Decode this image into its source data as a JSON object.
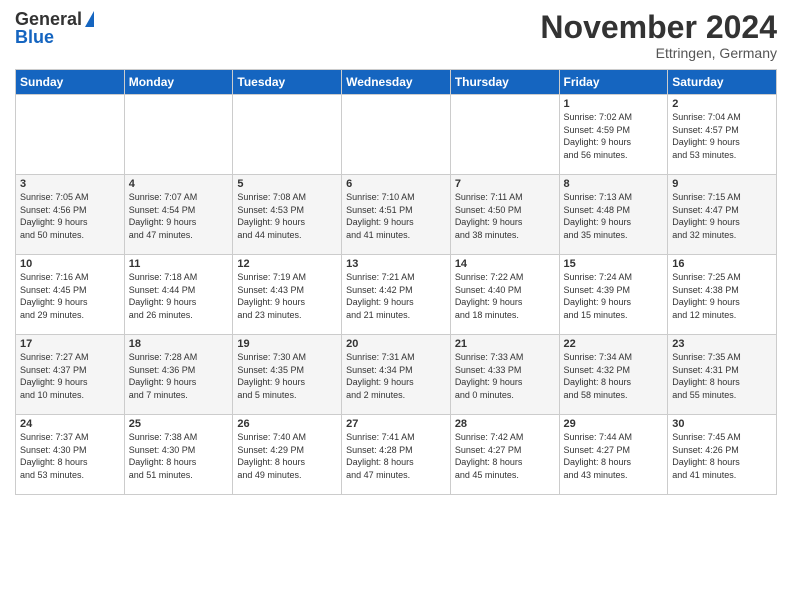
{
  "logo": {
    "general": "General",
    "blue": "Blue"
  },
  "title": "November 2024",
  "location": "Ettringen, Germany",
  "days_header": [
    "Sunday",
    "Monday",
    "Tuesday",
    "Wednesday",
    "Thursday",
    "Friday",
    "Saturday"
  ],
  "weeks": [
    {
      "cells": [
        {
          "day": "",
          "info": ""
        },
        {
          "day": "",
          "info": ""
        },
        {
          "day": "",
          "info": ""
        },
        {
          "day": "",
          "info": ""
        },
        {
          "day": "",
          "info": ""
        },
        {
          "day": "1",
          "info": "Sunrise: 7:02 AM\nSunset: 4:59 PM\nDaylight: 9 hours\nand 56 minutes."
        },
        {
          "day": "2",
          "info": "Sunrise: 7:04 AM\nSunset: 4:57 PM\nDaylight: 9 hours\nand 53 minutes."
        }
      ]
    },
    {
      "cells": [
        {
          "day": "3",
          "info": "Sunrise: 7:05 AM\nSunset: 4:56 PM\nDaylight: 9 hours\nand 50 minutes."
        },
        {
          "day": "4",
          "info": "Sunrise: 7:07 AM\nSunset: 4:54 PM\nDaylight: 9 hours\nand 47 minutes."
        },
        {
          "day": "5",
          "info": "Sunrise: 7:08 AM\nSunset: 4:53 PM\nDaylight: 9 hours\nand 44 minutes."
        },
        {
          "day": "6",
          "info": "Sunrise: 7:10 AM\nSunset: 4:51 PM\nDaylight: 9 hours\nand 41 minutes."
        },
        {
          "day": "7",
          "info": "Sunrise: 7:11 AM\nSunset: 4:50 PM\nDaylight: 9 hours\nand 38 minutes."
        },
        {
          "day": "8",
          "info": "Sunrise: 7:13 AM\nSunset: 4:48 PM\nDaylight: 9 hours\nand 35 minutes."
        },
        {
          "day": "9",
          "info": "Sunrise: 7:15 AM\nSunset: 4:47 PM\nDaylight: 9 hours\nand 32 minutes."
        }
      ]
    },
    {
      "cells": [
        {
          "day": "10",
          "info": "Sunrise: 7:16 AM\nSunset: 4:45 PM\nDaylight: 9 hours\nand 29 minutes."
        },
        {
          "day": "11",
          "info": "Sunrise: 7:18 AM\nSunset: 4:44 PM\nDaylight: 9 hours\nand 26 minutes."
        },
        {
          "day": "12",
          "info": "Sunrise: 7:19 AM\nSunset: 4:43 PM\nDaylight: 9 hours\nand 23 minutes."
        },
        {
          "day": "13",
          "info": "Sunrise: 7:21 AM\nSunset: 4:42 PM\nDaylight: 9 hours\nand 21 minutes."
        },
        {
          "day": "14",
          "info": "Sunrise: 7:22 AM\nSunset: 4:40 PM\nDaylight: 9 hours\nand 18 minutes."
        },
        {
          "day": "15",
          "info": "Sunrise: 7:24 AM\nSunset: 4:39 PM\nDaylight: 9 hours\nand 15 minutes."
        },
        {
          "day": "16",
          "info": "Sunrise: 7:25 AM\nSunset: 4:38 PM\nDaylight: 9 hours\nand 12 minutes."
        }
      ]
    },
    {
      "cells": [
        {
          "day": "17",
          "info": "Sunrise: 7:27 AM\nSunset: 4:37 PM\nDaylight: 9 hours\nand 10 minutes."
        },
        {
          "day": "18",
          "info": "Sunrise: 7:28 AM\nSunset: 4:36 PM\nDaylight: 9 hours\nand 7 minutes."
        },
        {
          "day": "19",
          "info": "Sunrise: 7:30 AM\nSunset: 4:35 PM\nDaylight: 9 hours\nand 5 minutes."
        },
        {
          "day": "20",
          "info": "Sunrise: 7:31 AM\nSunset: 4:34 PM\nDaylight: 9 hours\nand 2 minutes."
        },
        {
          "day": "21",
          "info": "Sunrise: 7:33 AM\nSunset: 4:33 PM\nDaylight: 9 hours\nand 0 minutes."
        },
        {
          "day": "22",
          "info": "Sunrise: 7:34 AM\nSunset: 4:32 PM\nDaylight: 8 hours\nand 58 minutes."
        },
        {
          "day": "23",
          "info": "Sunrise: 7:35 AM\nSunset: 4:31 PM\nDaylight: 8 hours\nand 55 minutes."
        }
      ]
    },
    {
      "cells": [
        {
          "day": "24",
          "info": "Sunrise: 7:37 AM\nSunset: 4:30 PM\nDaylight: 8 hours\nand 53 minutes."
        },
        {
          "day": "25",
          "info": "Sunrise: 7:38 AM\nSunset: 4:30 PM\nDaylight: 8 hours\nand 51 minutes."
        },
        {
          "day": "26",
          "info": "Sunrise: 7:40 AM\nSunset: 4:29 PM\nDaylight: 8 hours\nand 49 minutes."
        },
        {
          "day": "27",
          "info": "Sunrise: 7:41 AM\nSunset: 4:28 PM\nDaylight: 8 hours\nand 47 minutes."
        },
        {
          "day": "28",
          "info": "Sunrise: 7:42 AM\nSunset: 4:27 PM\nDaylight: 8 hours\nand 45 minutes."
        },
        {
          "day": "29",
          "info": "Sunrise: 7:44 AM\nSunset: 4:27 PM\nDaylight: 8 hours\nand 43 minutes."
        },
        {
          "day": "30",
          "info": "Sunrise: 7:45 AM\nSunset: 4:26 PM\nDaylight: 8 hours\nand 41 minutes."
        }
      ]
    }
  ]
}
